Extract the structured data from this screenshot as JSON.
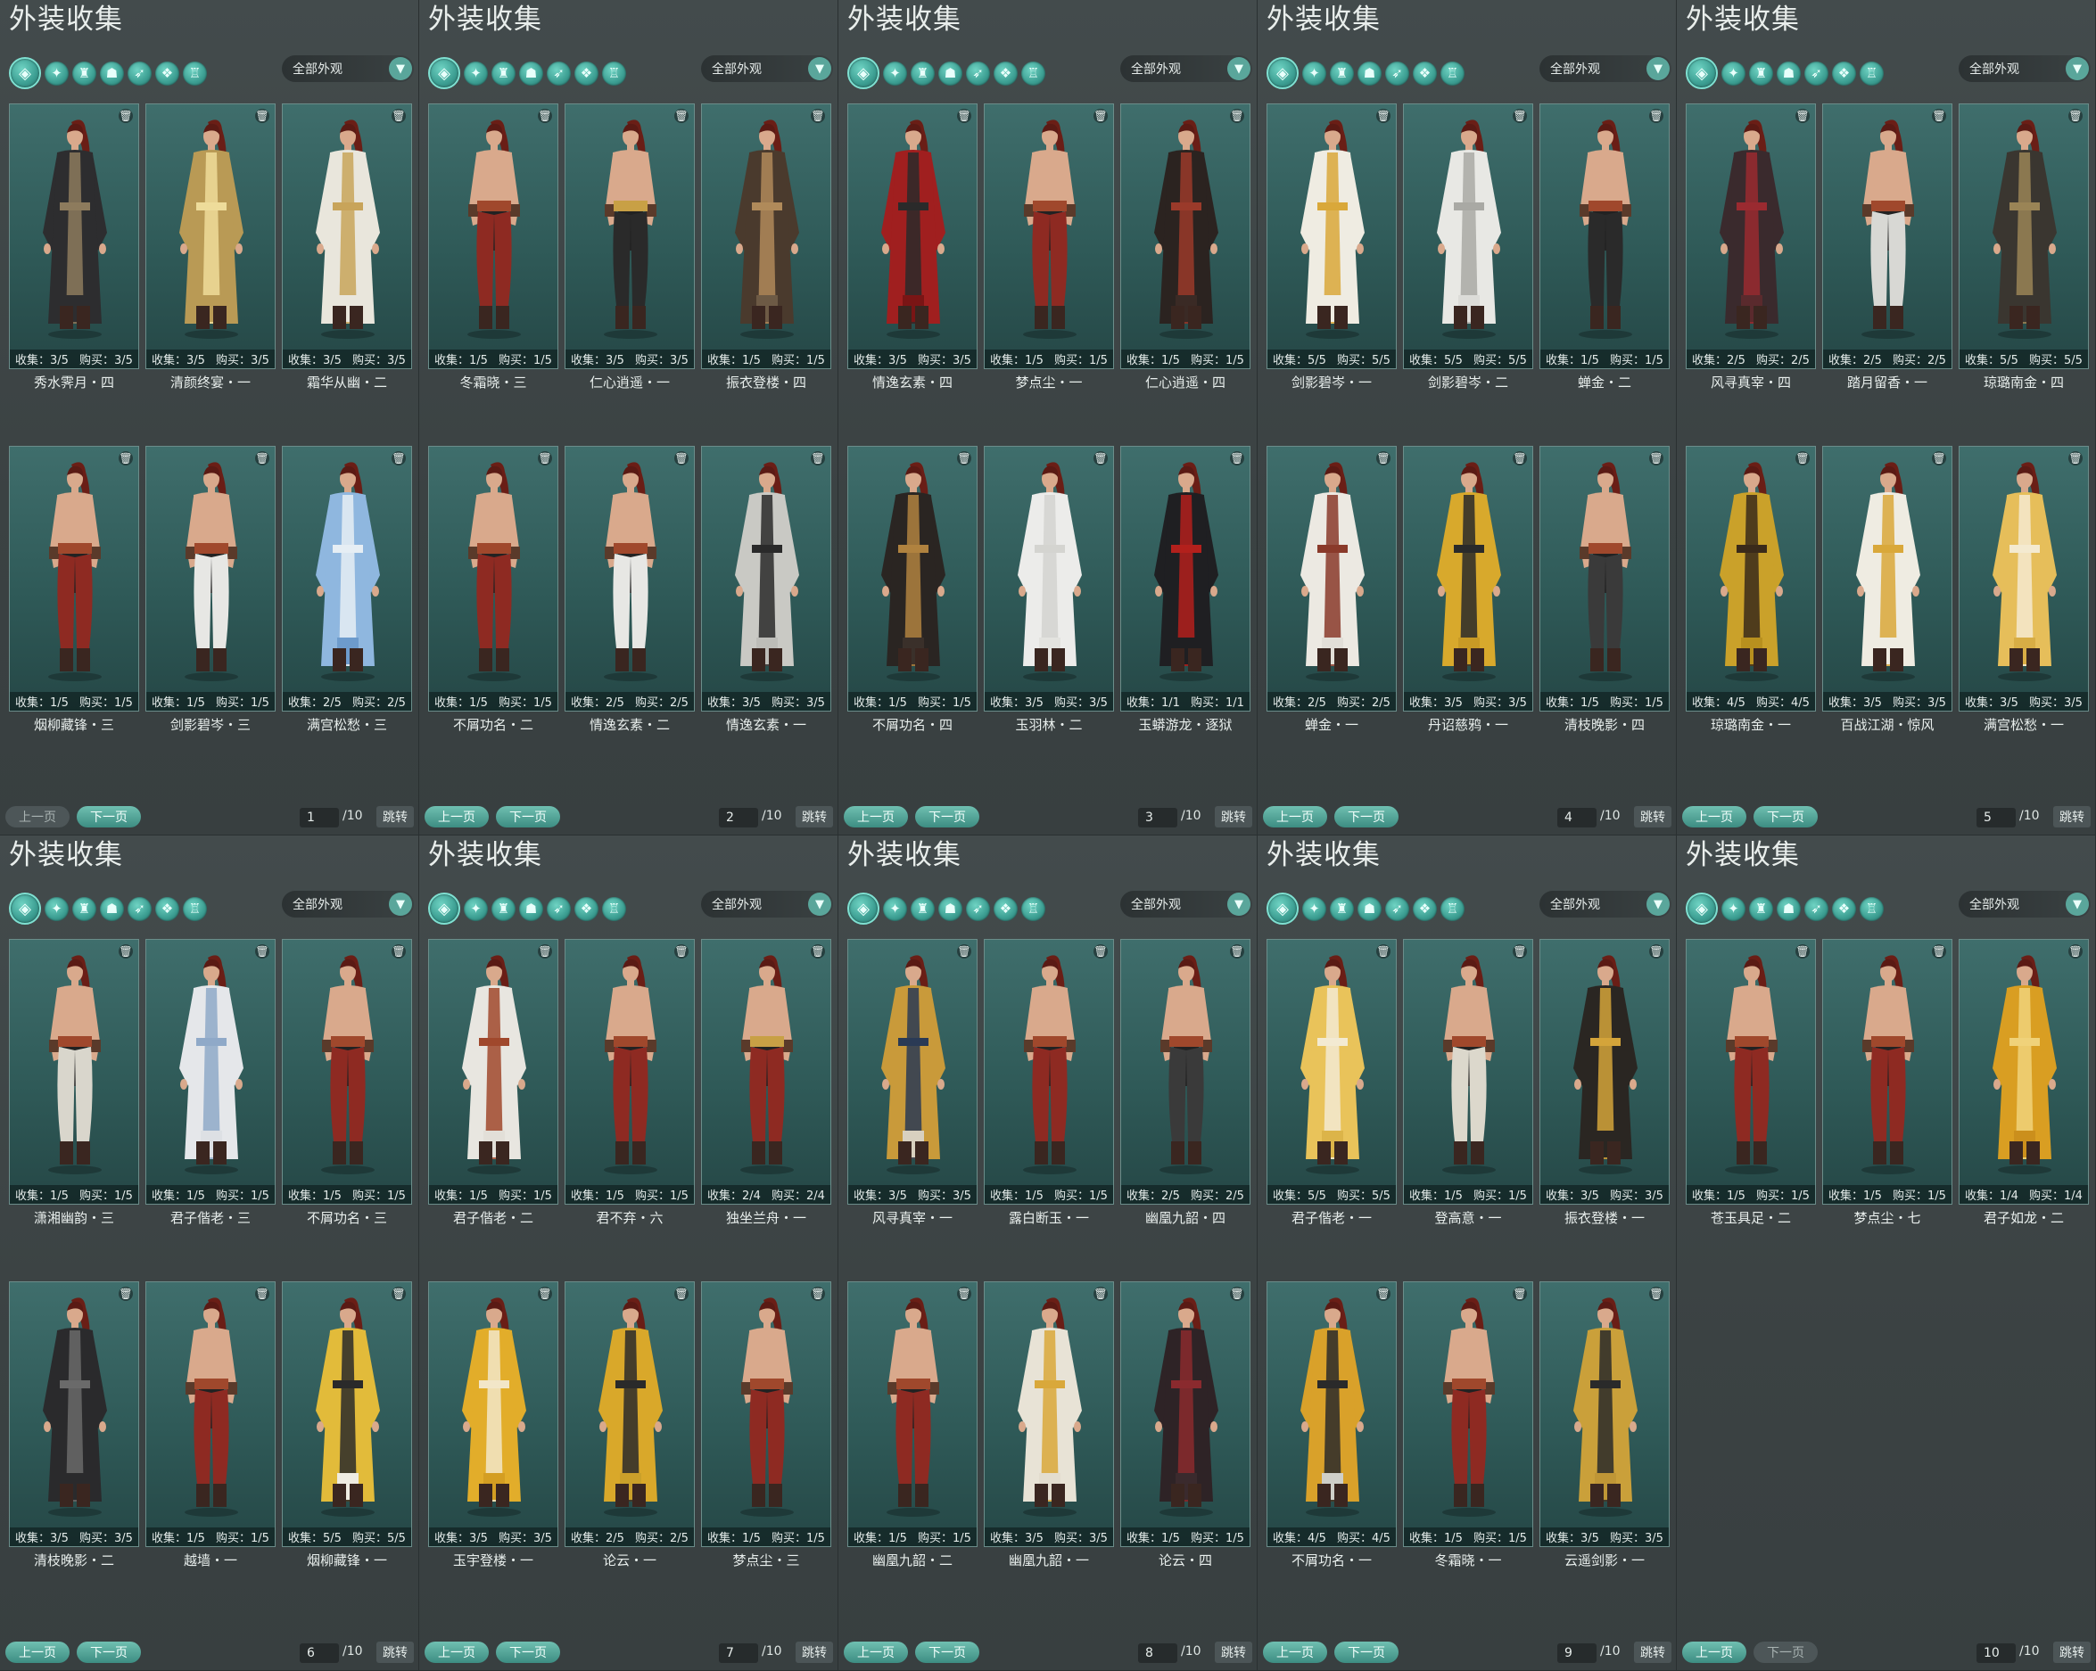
{
  "panel_title": "外装收集",
  "filter_label": "全部外观",
  "prev_label": "上一页",
  "next_label": "下一页",
  "jump_label": "跳转",
  "total_pages": "/10",
  "stat_collect_prefix": "收集：",
  "stat_buy_prefix": "购买：",
  "filter_icons": [
    "all-outfit-icon",
    "top-icon",
    "body-icon",
    "pants-icon",
    "shoes-icon",
    "hair-icon",
    "accessory-icon"
  ],
  "colors": {
    "accent": "#5aa69b",
    "card_bg": "#2f5a58",
    "panel_bg": "#3f4647"
  },
  "panels": [
    {
      "page": "1",
      "prev_enabled": false,
      "next_enabled": true,
      "items": [
        {
          "c": "3/5",
          "b": "3/5",
          "name": "秀水霁月・四",
          "outfit": "#2d2d2f",
          "trim": "#8d7b5d",
          "pants": "#2d2d2f",
          "shirtless": false
        },
        {
          "c": "3/5",
          "b": "3/5",
          "name": "清颜终宴・一",
          "outfit": "#b99a55",
          "trim": "#eedc9a",
          "pants": "#b99a55",
          "shirtless": false
        },
        {
          "c": "3/5",
          "b": "3/5",
          "name": "霜华从幽・二",
          "outfit": "#e9e6dc",
          "trim": "#c8a45a",
          "pants": "#e9e6dc",
          "shirtless": false
        },
        {
          "c": "1/5",
          "b": "1/5",
          "name": "烟柳藏锋・三",
          "outfit": "#222",
          "trim": "#a0482c",
          "pants": "#8e2a22",
          "shirtless": true
        },
        {
          "c": "1/5",
          "b": "1/5",
          "name": "剑影碧岑・三",
          "outfit": "#222",
          "trim": "#a0482c",
          "pants": "#e7e7e4",
          "shirtless": true
        },
        {
          "c": "2/5",
          "b": "2/5",
          "name": "满宫松愁・三",
          "outfit": "#8fb7df",
          "trim": "#e6eef4",
          "pants": "#6d9bcc",
          "shirtless": false
        }
      ]
    },
    {
      "page": "2",
      "prev_enabled": true,
      "next_enabled": true,
      "items": [
        {
          "c": "1/5",
          "b": "1/5",
          "name": "冬霜晓・三",
          "outfit": "#222",
          "trim": "#a0482c",
          "pants": "#8e2a22",
          "shirtless": true
        },
        {
          "c": "3/5",
          "b": "3/5",
          "name": "仁心逍遥・一",
          "outfit": "#222",
          "trim": "#c8a045",
          "pants": "#2a2a2a",
          "shirtless": true
        },
        {
          "c": "1/5",
          "b": "1/5",
          "name": "振衣登楼・四",
          "outfit": "#4a3a2d",
          "trim": "#b08a5a",
          "pants": "#6d5a45",
          "shirtless": false
        },
        {
          "c": "1/5",
          "b": "1/5",
          "name": "不屑功名・二",
          "outfit": "#222",
          "trim": "#a0482c",
          "pants": "#8e2a22",
          "shirtless": true
        },
        {
          "c": "2/5",
          "b": "2/5",
          "name": "情逸玄素・二",
          "outfit": "#222",
          "trim": "#a0482c",
          "pants": "#e7e7e4",
          "shirtless": true
        },
        {
          "c": "3/5",
          "b": "3/5",
          "name": "情逸玄素・一",
          "outfit": "#c9c9c4",
          "trim": "#2a2a2a",
          "pants": "#bdbdb8",
          "shirtless": false
        }
      ]
    },
    {
      "page": "3",
      "prev_enabled": true,
      "next_enabled": true,
      "items": [
        {
          "c": "3/5",
          "b": "3/5",
          "name": "情逸玄素・四",
          "outfit": "#a01f1f",
          "trim": "#2a2a2a",
          "pants": "#7a1515",
          "shirtless": false
        },
        {
          "c": "1/5",
          "b": "1/5",
          "name": "梦点尘・一",
          "outfit": "#222",
          "trim": "#a0482c",
          "pants": "#8e2a22",
          "shirtless": true
        },
        {
          "c": "1/5",
          "b": "1/5",
          "name": "仁心逍遥・四",
          "outfit": "#2b2320",
          "trim": "#9a3a2a",
          "pants": "#3a2a25",
          "shirtless": false
        },
        {
          "c": "1/5",
          "b": "1/5",
          "name": "不屑功名・四",
          "outfit": "#2a2522",
          "trim": "#b0823f",
          "pants": "#3a302a",
          "shirtless": false
        },
        {
          "c": "3/5",
          "b": "3/5",
          "name": "玉羽林・二",
          "outfit": "#ececea",
          "trim": "#d4d4d0",
          "pants": "#e3e3df",
          "shirtless": false
        },
        {
          "c": "1/1",
          "b": "1/1",
          "name": "玉蟒游龙・逐狱",
          "outfit": "#1f1f22",
          "trim": "#b3201c",
          "pants": "#1f1f22",
          "shirtless": false
        }
      ]
    },
    {
      "page": "4",
      "prev_enabled": true,
      "next_enabled": true,
      "items": [
        {
          "c": "5/5",
          "b": "5/5",
          "name": "剑影碧岑・一",
          "outfit": "#efece2",
          "trim": "#d9a83a",
          "pants": "#efece2",
          "shirtless": false
        },
        {
          "c": "5/5",
          "b": "5/5",
          "name": "剑影碧岑・二",
          "outfit": "#e8e8e4",
          "trim": "#a9a9a4",
          "pants": "#dcdcd8",
          "shirtless": false
        },
        {
          "c": "1/5",
          "b": "1/5",
          "name": "蝉金・二",
          "outfit": "#222",
          "trim": "#a0482c",
          "pants": "#2a2a2a",
          "shirtless": true
        },
        {
          "c": "2/5",
          "b": "2/5",
          "name": "蝉金・一",
          "outfit": "#ece9e2",
          "trim": "#8a3a2a",
          "pants": "#e2dfd8",
          "shirtless": false
        },
        {
          "c": "3/5",
          "b": "3/5",
          "name": "丹诏慈鸦・一",
          "outfit": "#d8a92c",
          "trim": "#2a2a2a",
          "pants": "#c89a25",
          "shirtless": false
        },
        {
          "c": "1/5",
          "b": "1/5",
          "name": "清枝晚影・四",
          "outfit": "#222",
          "trim": "#a0482c",
          "pants": "#3a3a3a",
          "shirtless": true
        }
      ]
    },
    {
      "page": "5",
      "prev_enabled": true,
      "next_enabled": true,
      "items": [
        {
          "c": "2/5",
          "b": "2/5",
          "name": "风寻真宰・四",
          "outfit": "#3a2a2d",
          "trim": "#9a2a30",
          "pants": "#5a2a2d",
          "shirtless": false
        },
        {
          "c": "2/5",
          "b": "2/5",
          "name": "踏月留香・一",
          "outfit": "#222",
          "trim": "#a0482c",
          "pants": "#d8d8d4",
          "shirtless": true
        },
        {
          "c": "5/5",
          "b": "5/5",
          "name": "琼璐南金・四",
          "outfit": "#3a3630",
          "trim": "#9a8456",
          "pants": "#3a3630",
          "shirtless": false
        },
        {
          "c": "4/5",
          "b": "4/5",
          "name": "琼璐南金・一",
          "outfit": "#caa12a",
          "trim": "#3a2a1a",
          "pants": "#b8901e",
          "shirtless": false
        },
        {
          "c": "3/5",
          "b": "3/5",
          "name": "百战江湖・惊风",
          "outfit": "#efece2",
          "trim": "#d9a83a",
          "pants": "#efece2",
          "shirtless": false
        },
        {
          "c": "3/5",
          "b": "3/5",
          "name": "满宫松愁・一",
          "outfit": "#e6be5a",
          "trim": "#f4ead0",
          "pants": "#d8ad45",
          "shirtless": false
        }
      ]
    },
    {
      "page": "6",
      "prev_enabled": true,
      "next_enabled": true,
      "items": [
        {
          "c": "1/5",
          "b": "1/5",
          "name": "潇湘幽韵・三",
          "outfit": "#222",
          "trim": "#a0482c",
          "pants": "#d9d6cc",
          "shirtless": true
        },
        {
          "c": "1/5",
          "b": "1/5",
          "name": "君子偕老・三",
          "outfit": "#e5e7ea",
          "trim": "#8fa9c8",
          "pants": "#dde0e4",
          "shirtless": false
        },
        {
          "c": "1/5",
          "b": "1/5",
          "name": "不屑功名・三",
          "outfit": "#222",
          "trim": "#a0482c",
          "pants": "#8e2a22",
          "shirtless": true
        },
        {
          "c": "3/5",
          "b": "3/5",
          "name": "清枝晚影・二",
          "outfit": "#2a2a2c",
          "trim": "#6a6a6a",
          "pants": "#2a2a2c",
          "shirtless": false
        },
        {
          "c": "1/5",
          "b": "1/5",
          "name": "越墙・一",
          "outfit": "#222",
          "trim": "#a0482c",
          "pants": "#8e2a22",
          "shirtless": true
        },
        {
          "c": "5/5",
          "b": "5/5",
          "name": "烟柳藏锋・一",
          "outfit": "#e2bb3a",
          "trim": "#2a2a2a",
          "pants": "#efece2",
          "shirtless": false
        }
      ]
    },
    {
      "page": "7",
      "prev_enabled": true,
      "next_enabled": true,
      "items": [
        {
          "c": "1/5",
          "b": "1/5",
          "name": "君子偕老・二",
          "outfit": "#e8e6e0",
          "trim": "#a0482c",
          "pants": "#e2dfd8",
          "shirtless": false
        },
        {
          "c": "1/5",
          "b": "1/5",
          "name": "君不弃・六",
          "outfit": "#222",
          "trim": "#a0482c",
          "pants": "#8e2a22",
          "shirtless": true
        },
        {
          "c": "2/4",
          "b": "2/4",
          "name": "独坐兰舟・一",
          "outfit": "#222",
          "trim": "#c8a045",
          "pants": "#8e2a22",
          "shirtless": true
        },
        {
          "c": "3/5",
          "b": "3/5",
          "name": "玉宇登楼・一",
          "outfit": "#e2ad2a",
          "trim": "#f2e6c8",
          "pants": "#d49e22",
          "shirtless": false
        },
        {
          "c": "2/5",
          "b": "2/5",
          "name": "论云・一",
          "outfit": "#d9a82a",
          "trim": "#2a2a2a",
          "pants": "#caa02a",
          "shirtless": false
        },
        {
          "c": "1/5",
          "b": "1/5",
          "name": "梦点尘・三",
          "outfit": "#222",
          "trim": "#a0482c",
          "pants": "#8e2a22",
          "shirtless": true
        }
      ]
    },
    {
      "page": "8",
      "prev_enabled": true,
      "next_enabled": true,
      "items": [
        {
          "c": "3/5",
          "b": "3/5",
          "name": "风寻真宰・一",
          "outfit": "#c99a3a",
          "trim": "#2a3a55",
          "pants": "#d8d0bf",
          "shirtless": false
        },
        {
          "c": "1/5",
          "b": "1/5",
          "name": "露白断玉・一",
          "outfit": "#222",
          "trim": "#a0482c",
          "pants": "#8e2a22",
          "shirtless": true
        },
        {
          "c": "2/5",
          "b": "2/5",
          "name": "幽凰九韶・四",
          "outfit": "#222",
          "trim": "#a0482c",
          "pants": "#3a3a3a",
          "shirtless": true
        },
        {
          "c": "1/5",
          "b": "1/5",
          "name": "幽凰九韶・二",
          "outfit": "#222",
          "trim": "#a0482c",
          "pants": "#8e2a22",
          "shirtless": true
        },
        {
          "c": "3/5",
          "b": "3/5",
          "name": "幽凰九韶・一",
          "outfit": "#e8e3d6",
          "trim": "#d9a83a",
          "pants": "#e3ddcf",
          "shirtless": false
        },
        {
          "c": "1/5",
          "b": "1/5",
          "name": "论云・四",
          "outfit": "#2e2326",
          "trim": "#8a2a2e",
          "pants": "#3a2a2d",
          "shirtless": false
        }
      ]
    },
    {
      "page": "9",
      "prev_enabled": true,
      "next_enabled": true,
      "items": [
        {
          "c": "5/5",
          "b": "5/5",
          "name": "君子偕老・一",
          "outfit": "#e9c35a",
          "trim": "#f3ead2",
          "pants": "#dcb449",
          "shirtless": false
        },
        {
          "c": "1/5",
          "b": "1/5",
          "name": "登高意・一",
          "outfit": "#222",
          "trim": "#a0482c",
          "pants": "#dcd8cc",
          "shirtless": true
        },
        {
          "c": "3/5",
          "b": "3/5",
          "name": "振衣登楼・一",
          "outfit": "#2a2622",
          "trim": "#d4a43a",
          "pants": "#2a2622",
          "shirtless": false
        },
        {
          "c": "4/5",
          "b": "4/5",
          "name": "不屑功名・一",
          "outfit": "#d9a12a",
          "trim": "#2a2a2a",
          "pants": "#cfcfc8",
          "shirtless": false
        },
        {
          "c": "1/5",
          "b": "1/5",
          "name": "冬霜晓・一",
          "outfit": "#222",
          "trim": "#a0482c",
          "pants": "#8e2a22",
          "shirtless": true
        },
        {
          "c": "3/5",
          "b": "3/5",
          "name": "云遥剑影・一",
          "outfit": "#caa03a",
          "trim": "#2a2a2a",
          "pants": "#bf9636",
          "shirtless": false
        }
      ]
    },
    {
      "page": "10",
      "prev_enabled": true,
      "next_enabled": false,
      "items": [
        {
          "c": "1/5",
          "b": "1/5",
          "name": "苍玉具足・二",
          "outfit": "#222",
          "trim": "#a0482c",
          "pants": "#8e2a22",
          "shirtless": true
        },
        {
          "c": "1/5",
          "b": "1/5",
          "name": "梦点尘・七",
          "outfit": "#222",
          "trim": "#a0482c",
          "pants": "#8e2a22",
          "shirtless": true
        },
        {
          "c": "1/4",
          "b": "1/4",
          "name": "君子如龙・二",
          "outfit": "#d99e22",
          "trim": "#f0d27a",
          "pants": "#cb8f1c",
          "shirtless": false
        }
      ]
    }
  ]
}
